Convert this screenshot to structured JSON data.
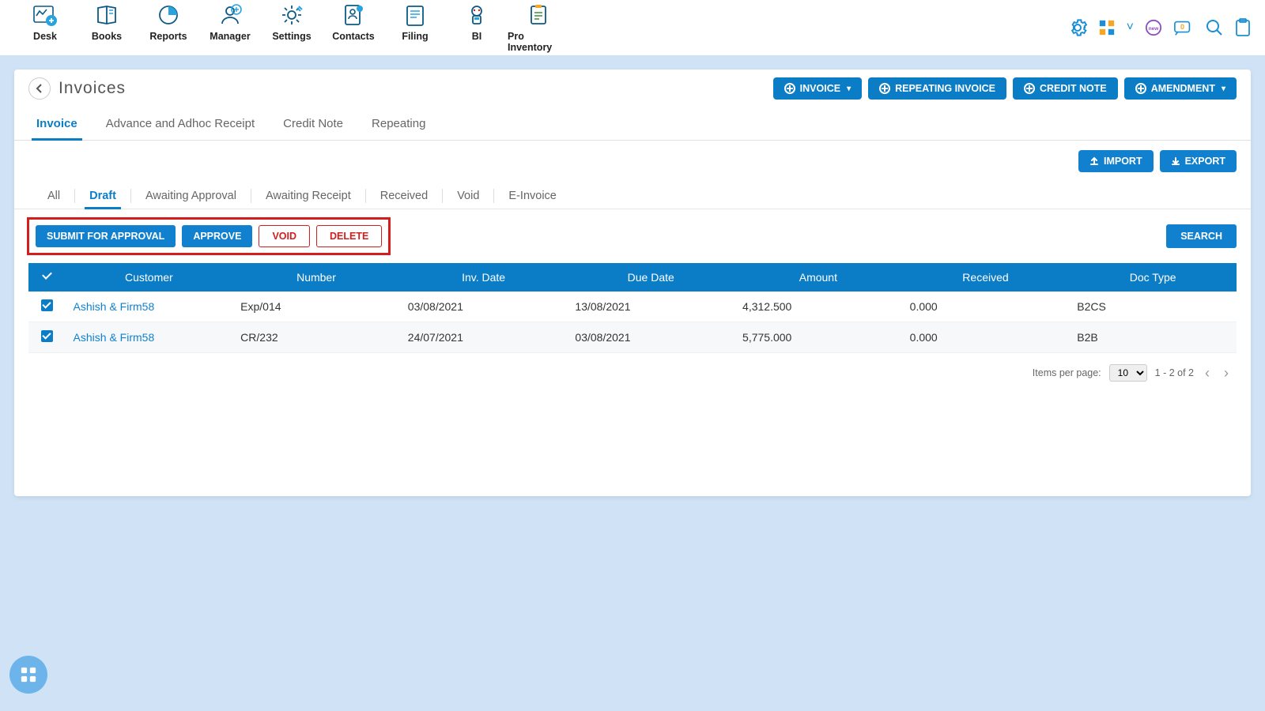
{
  "topnav": {
    "items": [
      {
        "label": "Desk"
      },
      {
        "label": "Books"
      },
      {
        "label": "Reports"
      },
      {
        "label": "Manager"
      },
      {
        "label": "Settings"
      },
      {
        "label": "Contacts"
      },
      {
        "label": "Filing"
      },
      {
        "label": "BI"
      },
      {
        "label": "Pro Inventory"
      }
    ]
  },
  "header": {
    "title": "Invoices",
    "buttons": {
      "invoice": "INVOICE",
      "repeating": "REPEATING INVOICE",
      "creditnote": "CREDIT NOTE",
      "amendment": "AMENDMENT"
    }
  },
  "tabs": {
    "items": [
      "Invoice",
      "Advance and Adhoc Receipt",
      "Credit Note",
      "Repeating"
    ],
    "activeIndex": 0
  },
  "importexport": {
    "import": "IMPORT",
    "export": "EXPORT"
  },
  "filterTabs": {
    "items": [
      "All",
      "Draft",
      "Awaiting Approval",
      "Awaiting Receipt",
      "Received",
      "Void",
      "E-Invoice"
    ],
    "activeIndex": 1
  },
  "actions": {
    "submit": "SUBMIT FOR APPROVAL",
    "approve": "APPROVE",
    "void": "VOID",
    "delete": "DELETE",
    "search": "SEARCH"
  },
  "table": {
    "columns": [
      "Customer",
      "Number",
      "Inv. Date",
      "Due Date",
      "Amount",
      "Received",
      "Doc Type"
    ],
    "rows": [
      {
        "customer": "Ashish & Firm58",
        "number": "Exp/014",
        "invDate": "03/08/2021",
        "dueDate": "13/08/2021",
        "amount": "4,312.500",
        "received": "0.000",
        "docType": "B2CS",
        "checked": true
      },
      {
        "customer": "Ashish & Firm58",
        "number": "CR/232",
        "invDate": "24/07/2021",
        "dueDate": "03/08/2021",
        "amount": "5,775.000",
        "received": "0.000",
        "docType": "B2B",
        "checked": true
      }
    ]
  },
  "pager": {
    "itemsPerPageLabel": "Items per page:",
    "perPage": "10",
    "rangeText": "1 - 2 of 2"
  },
  "utility": {
    "notificationCount": "0"
  }
}
